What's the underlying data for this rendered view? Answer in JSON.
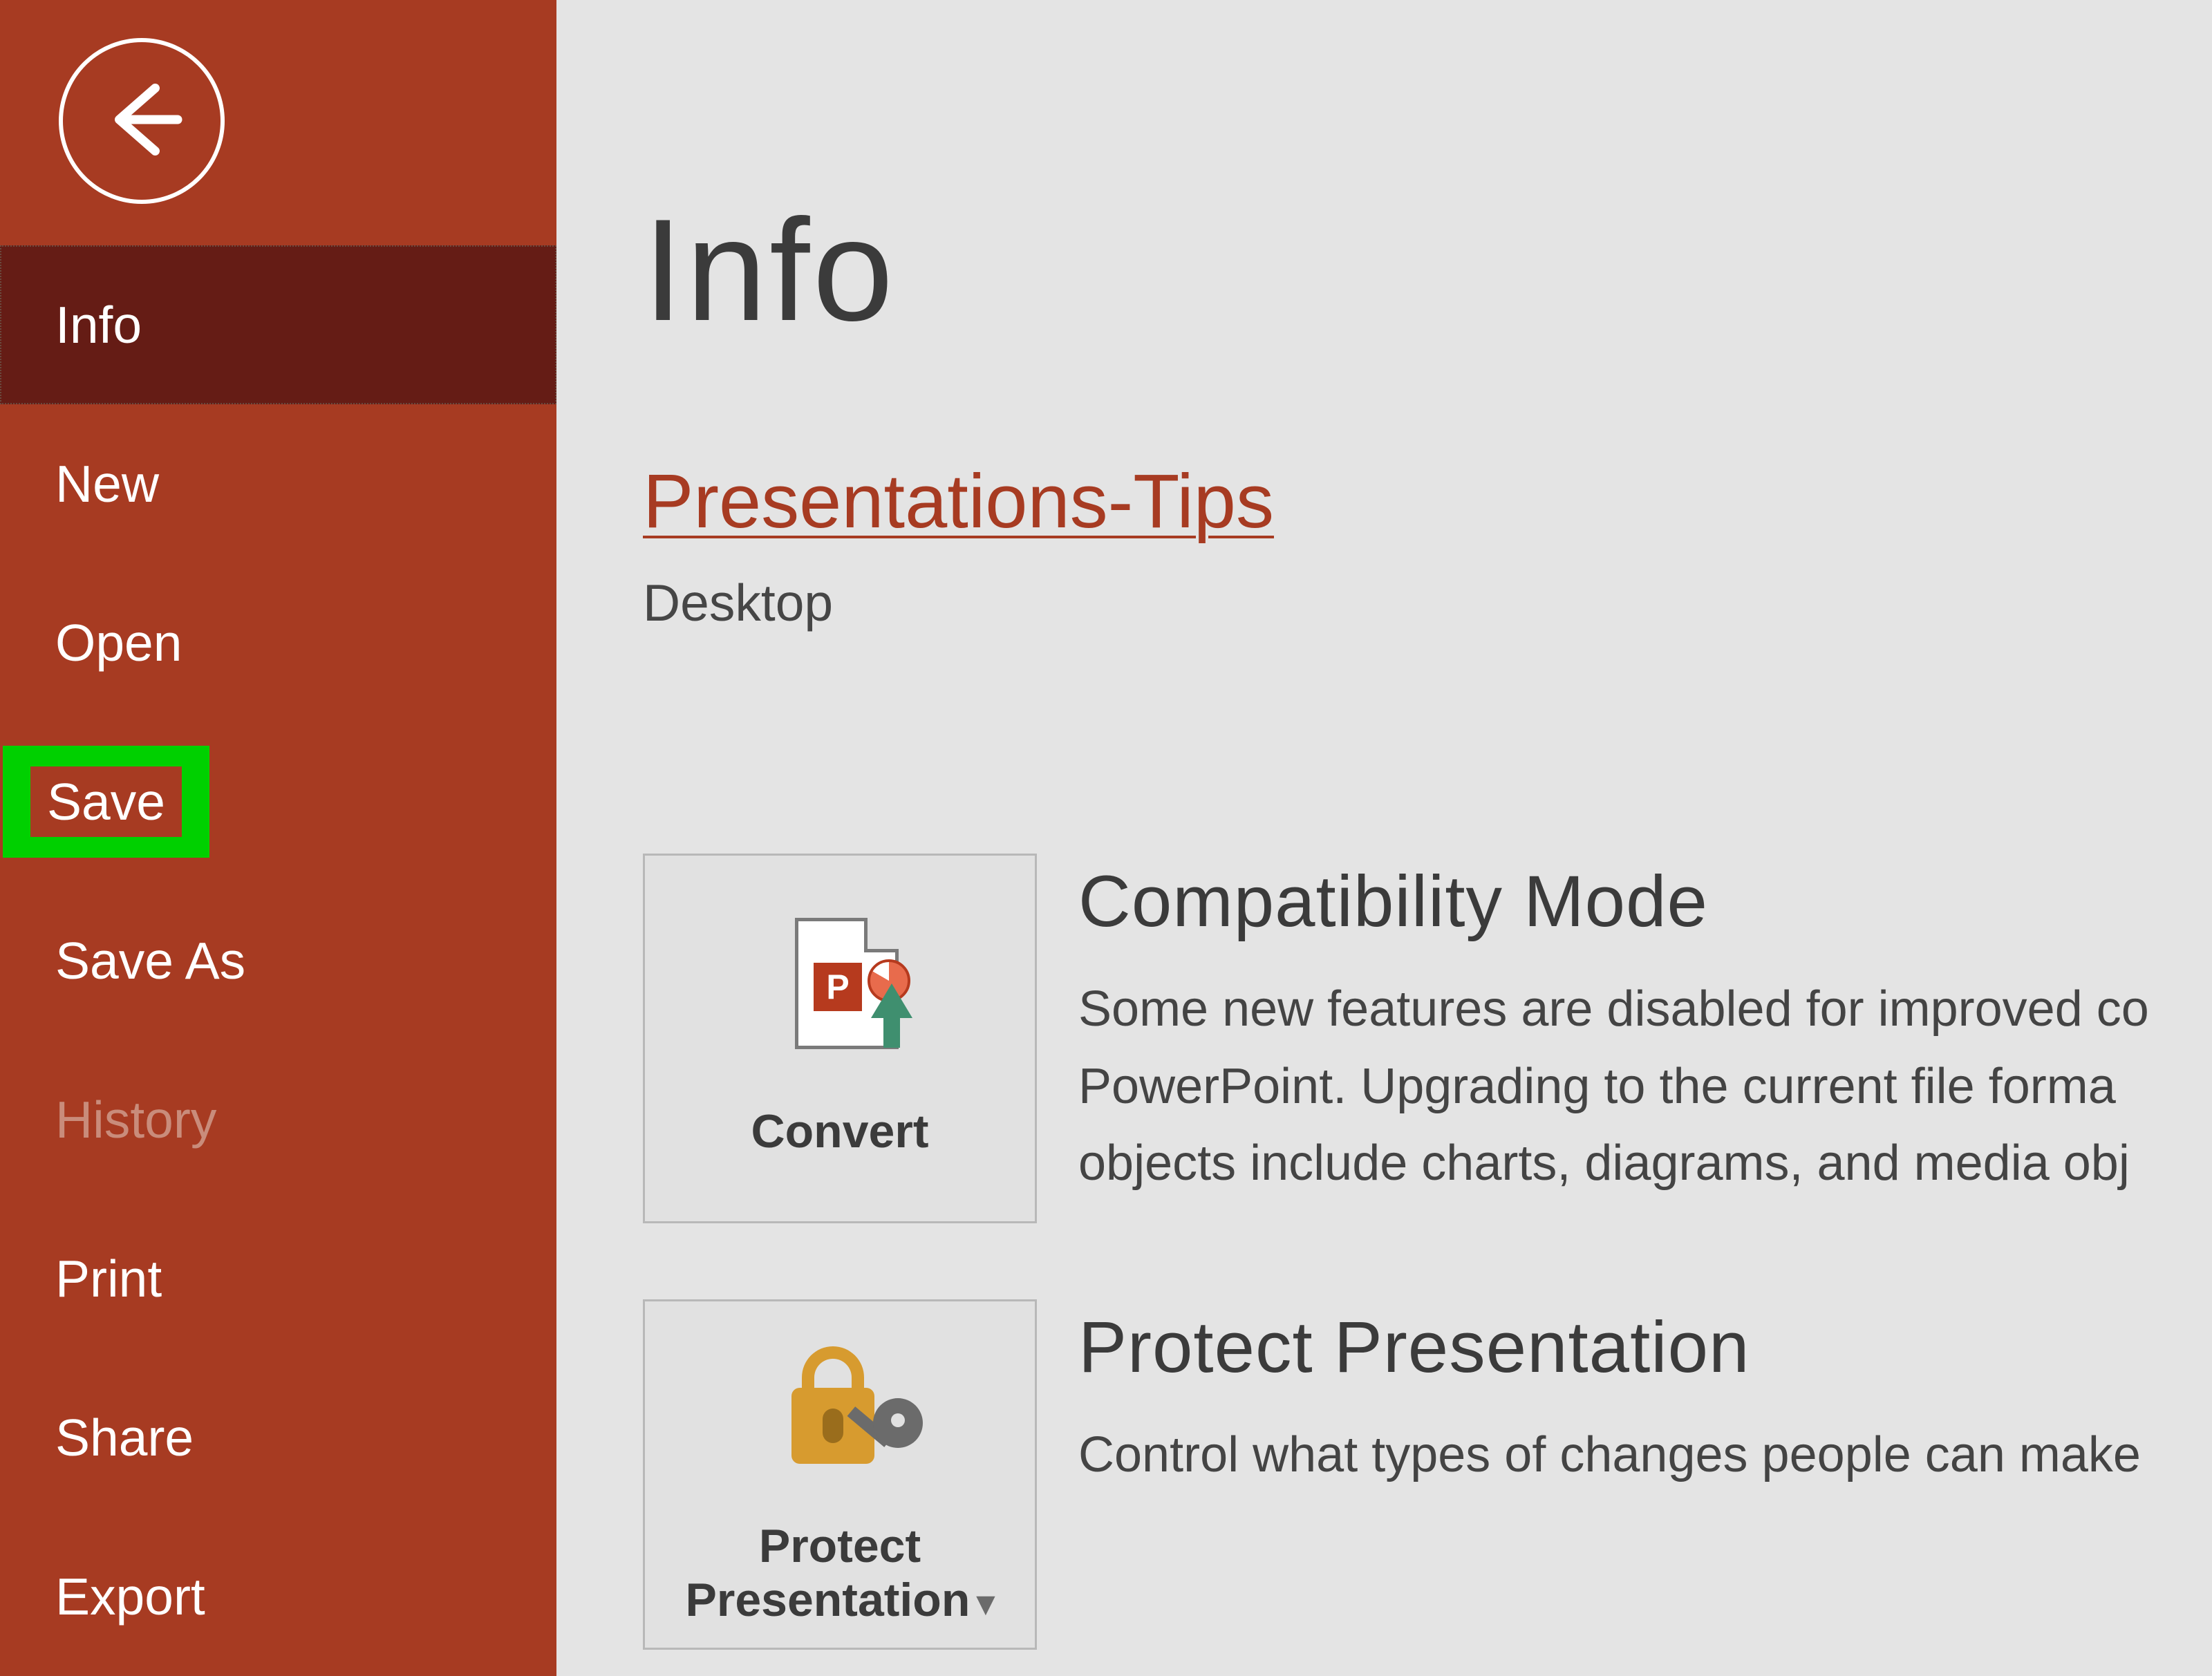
{
  "sidebar": {
    "items": [
      {
        "label": "Info"
      },
      {
        "label": "New"
      },
      {
        "label": "Open"
      },
      {
        "label": "Save"
      },
      {
        "label": "Save As"
      },
      {
        "label": "History"
      },
      {
        "label": "Print"
      },
      {
        "label": "Share"
      },
      {
        "label": "Export"
      }
    ]
  },
  "main": {
    "page_title": "Info",
    "document_title": "Presentations-Tips",
    "document_location": "Desktop",
    "sections": [
      {
        "tile_label": "Convert",
        "heading": "Compatibility Mode",
        "body_line1": "Some new features are disabled for improved co",
        "body_line2": "PowerPoint. Upgrading to the current file forma",
        "body_line3": "objects include charts, diagrams, and media obj"
      },
      {
        "tile_label": "Protect\nPresentation",
        "heading": "Protect Presentation",
        "body_line1": "Control what types of changes people can make"
      }
    ]
  }
}
